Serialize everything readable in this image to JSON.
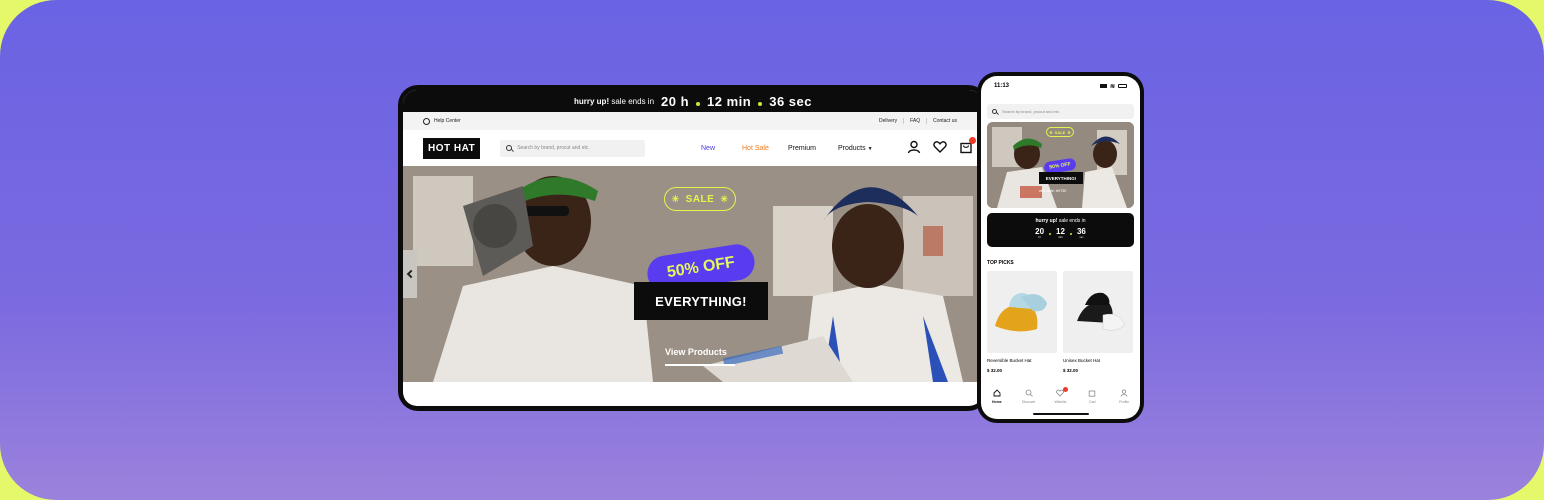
{
  "colors": {
    "accent_purple": "#5a3cf0",
    "accent_lime": "#e3f64c",
    "hot_orange": "#f07a1c",
    "new_blue": "#4a3ce6",
    "badge_red": "#ee3b2b"
  },
  "tablet": {
    "timer": {
      "lead_bold": "hurry up!",
      "lead_rest": " sale ends in",
      "hours": "20 h",
      "minutes": "12 min",
      "seconds": "36 sec"
    },
    "utility": {
      "help": "Help Center",
      "delivery": "Delivery",
      "faq": "FAQ",
      "contact": "Contact us"
    },
    "nav": {
      "logo": "HOT HAT",
      "search_placeholder": "Search by brand, procut and etc.",
      "links": {
        "new": "New",
        "hot_sale": "Hot Sale",
        "premium": "Premium",
        "products": "Products"
      }
    },
    "hero": {
      "sale": "SALE",
      "off": "50% OFF",
      "everything": "EVERYTHING!",
      "cta": "View Products"
    }
  },
  "phone": {
    "time": "11:13",
    "search_placeholder": "Search by brand, procut and etc.",
    "hero": {
      "sale": "SALE",
      "off": "50% OFF",
      "everything": "EVERYTHING!",
      "code": "with code: #HT50"
    },
    "timer": {
      "lead_bold": "hurry up!",
      "lead_rest": " sale ends in",
      "h": "20",
      "m": "12",
      "s": "36",
      "h_unit": "hr",
      "m_unit": "min",
      "s_unit": "sec"
    },
    "top_picks": "TOP PICKS",
    "products": [
      {
        "name": "Reversible Bucket Hat",
        "price": "$ 32.00"
      },
      {
        "name": "Unisex Bucket Hat",
        "price": "$ 32.00"
      }
    ],
    "tabs": [
      "Home",
      "Discover",
      "Wishlist",
      "Cart",
      "Profile"
    ]
  }
}
